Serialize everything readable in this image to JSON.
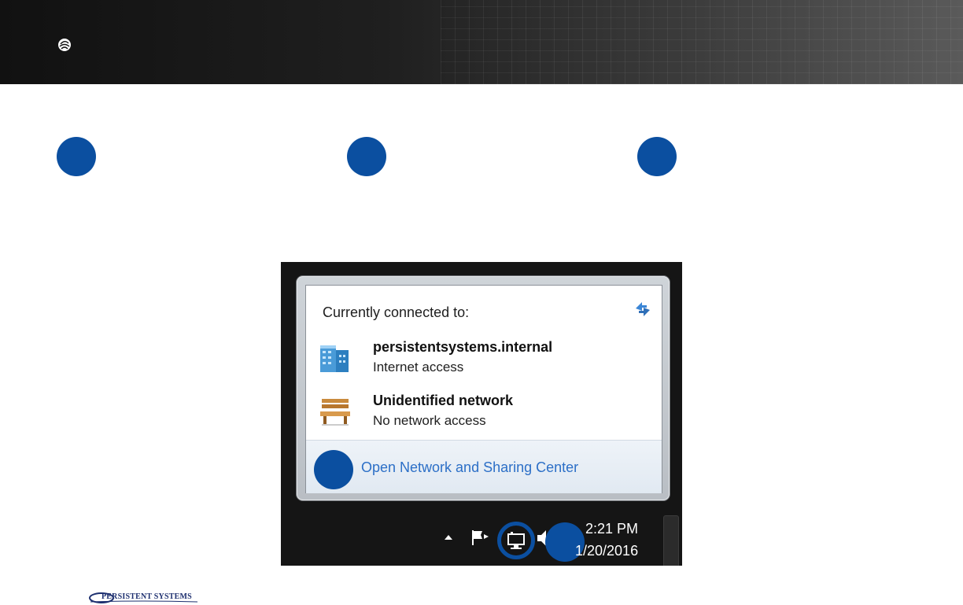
{
  "header": {
    "logo_icon": "persistent-logo-mark-icon"
  },
  "flyout": {
    "heading": "Currently connected to:",
    "refresh_icon": "refresh-arrows-icon",
    "networks": [
      {
        "name": "persistentsystems.internal",
        "status": "Internet access",
        "icon": "domain-network-building-icon"
      },
      {
        "name": "Unidentified network",
        "status": "No network access",
        "icon": "public-network-bench-icon"
      }
    ],
    "open_center_link": "Open Network and Sharing Center"
  },
  "taskbar": {
    "time": "2:21 PM",
    "date": "1/20/2016",
    "icons": [
      "show-hidden-icons-icon",
      "action-center-flag-icon",
      "network-icon",
      "speaker-icon"
    ]
  },
  "brand": {
    "text": "PERSISTENT SYSTEMS"
  },
  "colors": {
    "step_circle": "#0b4fa0",
    "link": "#2c6fc7",
    "taskbar": "#151515"
  }
}
